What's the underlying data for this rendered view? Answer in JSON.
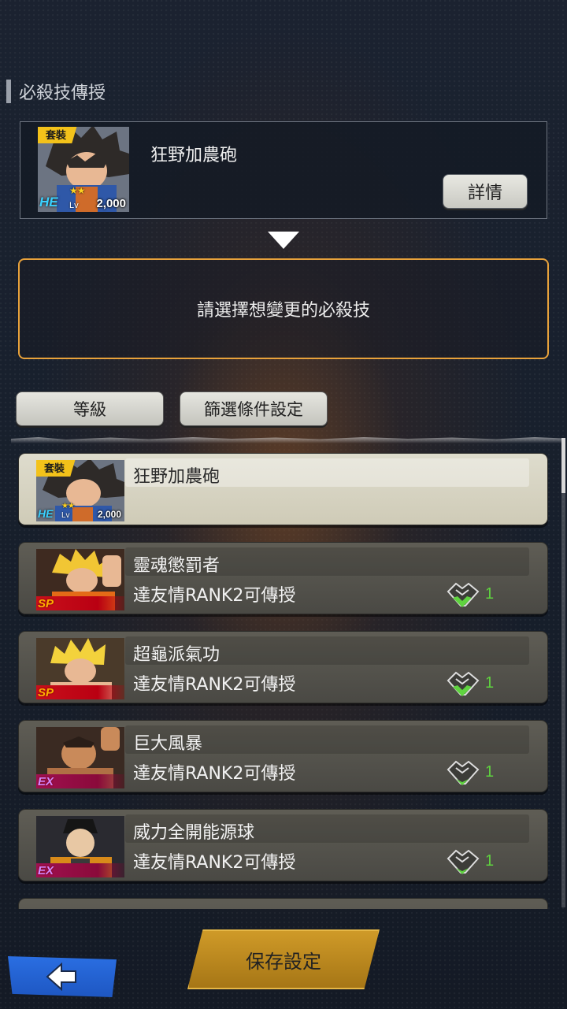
{
  "section": {
    "title": "必殺技傳授"
  },
  "top_card": {
    "tag": "套裝",
    "name": "狂野加農砲",
    "badge": "HE",
    "level_prefix": "Lv",
    "level": "2,000",
    "detail_label": "詳情"
  },
  "prompt": {
    "text": "請選擇想變更的必殺技"
  },
  "filters": {
    "level_label": "等級",
    "filter_label": "篩選條件設定"
  },
  "list": {
    "items": [
      {
        "tag": "套裝",
        "name": "狂野加農砲",
        "badge": "HE",
        "level_prefix": "Lv",
        "level": "2,000",
        "selected": true
      },
      {
        "name": "靈魂懲罰者",
        "requirement": "達友情RANK2可傳授",
        "rarity": "SP",
        "friend_count": "1"
      },
      {
        "name": "超龜派氣功",
        "requirement": "達友情RANK2可傳授",
        "rarity": "SP",
        "friend_count": "1"
      },
      {
        "name": "巨大風暴",
        "requirement": "達友情RANK2可傳授",
        "rarity": "EX",
        "friend_count": "1"
      },
      {
        "name": "威力全開能源球",
        "requirement": "達友情RANK2可傳授",
        "rarity": "EX",
        "friend_count": "1"
      }
    ]
  },
  "footer": {
    "save_label": "保存設定"
  },
  "icons": {
    "back": "back-arrow-icon",
    "friend": "handshake-icon",
    "down": "down-triangle-icon"
  },
  "colors": {
    "accent_orange": "#e8a23b",
    "save_gold": "#cf9a28",
    "back_blue": "#2a6ee2",
    "friend_green": "#5fd33f"
  }
}
